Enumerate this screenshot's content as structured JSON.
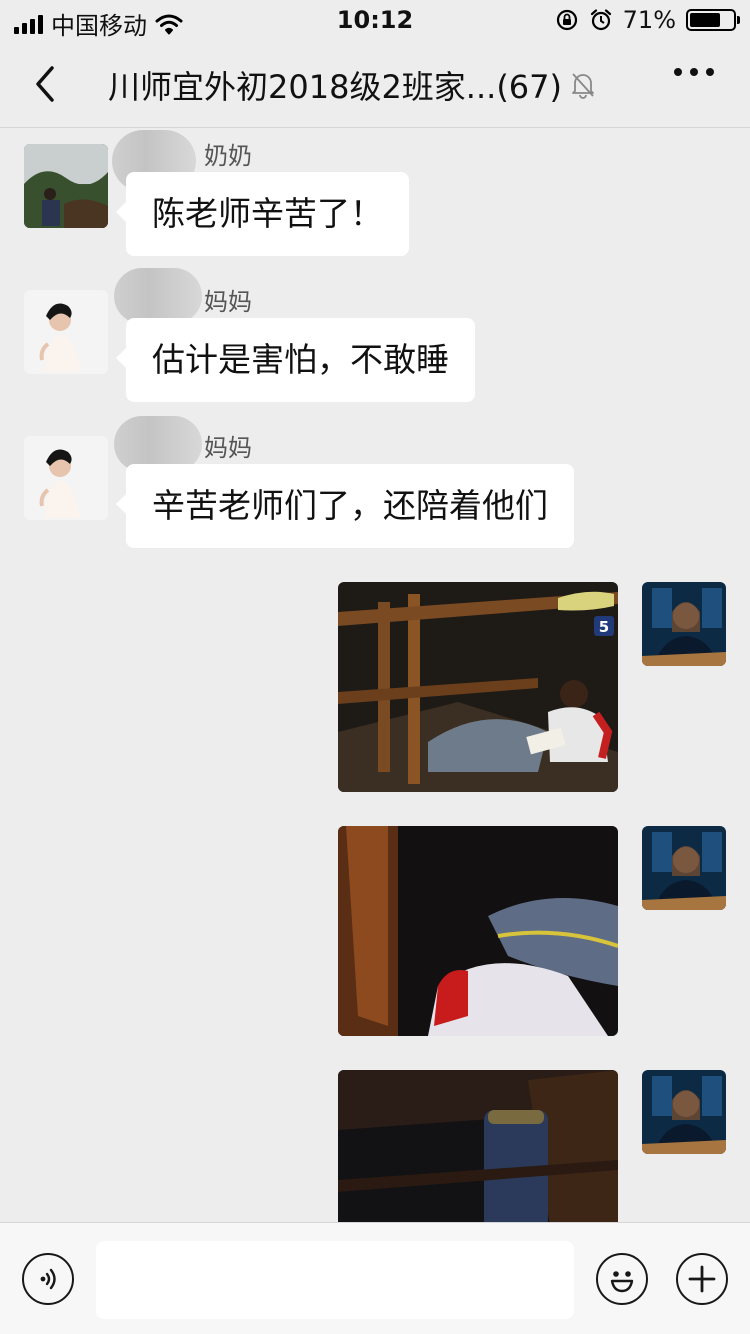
{
  "status_bar": {
    "carrier": "中国移动",
    "time": "10:12",
    "battery_percent": "71%",
    "battery_level": 0.71
  },
  "header": {
    "title": "川师宜外初2018级2班家...(67)"
  },
  "messages": [
    {
      "sender": "奶奶",
      "text": "陈老师辛苦了！"
    },
    {
      "sender": "妈妈",
      "text": "估计是害怕，不敢睡"
    },
    {
      "sender": "妈妈",
      "text": "辛苦老师们了，还陪着他们"
    }
  ],
  "photos": [
    {
      "badge": "5"
    }
  ],
  "icons": {
    "back": "chevron-left-icon",
    "mute": "bell-off-icon",
    "more": "more-dots-icon",
    "voice": "voice-icon",
    "emoji": "emoji-icon",
    "add": "plus-icon"
  }
}
